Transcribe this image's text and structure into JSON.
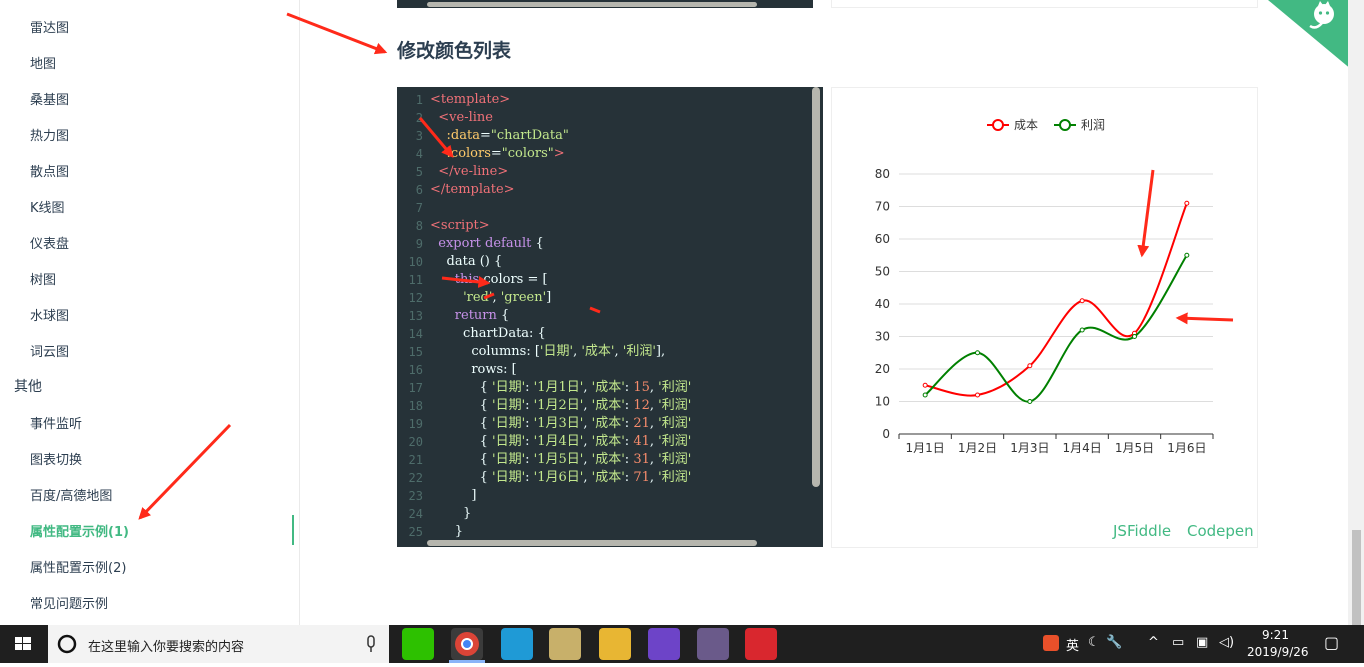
{
  "sidebar": {
    "items": [
      {
        "label": "雷达图",
        "active": false
      },
      {
        "label": "地图",
        "active": false
      },
      {
        "label": "桑基图",
        "active": false
      },
      {
        "label": "热力图",
        "active": false
      },
      {
        "label": "散点图",
        "active": false
      },
      {
        "label": "K线图",
        "active": false
      },
      {
        "label": "仪表盘",
        "active": false
      },
      {
        "label": "树图",
        "active": false
      },
      {
        "label": "水球图",
        "active": false
      },
      {
        "label": "词云图",
        "active": false
      }
    ],
    "group_label": "其他",
    "group_items": [
      {
        "label": "事件监听",
        "active": false
      },
      {
        "label": "图表切换",
        "active": false
      },
      {
        "label": "百度/高德地图",
        "active": false
      },
      {
        "label": "属性配置示例(1)",
        "active": true
      },
      {
        "label": "属性配置示例(2)",
        "active": false
      },
      {
        "label": "常见问题示例",
        "active": false
      }
    ]
  },
  "main": {
    "section_title": "修改颜色列表",
    "links": {
      "jsfiddle": "JSFiddle",
      "codepen": "Codepen"
    }
  },
  "code": {
    "line_numbers": [
      "1",
      "2",
      "3",
      "4",
      "5",
      "6",
      "7",
      "8",
      "9",
      "10",
      "11",
      "12",
      "13",
      "14",
      "15",
      "16",
      "17",
      "18",
      "19",
      "20",
      "21",
      "22",
      "23",
      "24",
      "25"
    ],
    "lines": [
      "<template>",
      "  <ve-line",
      "    :data=\"chartData\"",
      "    :colors=\"colors\">",
      "  </ve-line>",
      "</template>",
      "",
      "<script>",
      "  export default {",
      "    data () {",
      "      this.colors = [",
      "        'red', 'green']",
      "      return {",
      "        chartData: {",
      "          columns: ['日期', '成本', '利润'],",
      "          rows: [",
      "            { '日期': '1月1日', '成本': 15, '利润'",
      "            { '日期': '1月2日', '成本': 12, '利润'",
      "            { '日期': '1月3日', '成本': 21, '利润'",
      "            { '日期': '1月4日', '成本': 41, '利润'",
      "            { '日期': '1月5日', '成本': 31, '利润'",
      "            { '日期': '1月6日', '成本': 71, '利润'",
      "          ]",
      "        }",
      "      }"
    ]
  },
  "chart_data": {
    "type": "line",
    "categories": [
      "1月1日",
      "1月2日",
      "1月3日",
      "1月4日",
      "1月5日",
      "1月6日"
    ],
    "series": [
      {
        "name": "成本",
        "color": "#ff0000",
        "values": [
          15,
          12,
          21,
          41,
          31,
          71
        ]
      },
      {
        "name": "利润",
        "color": "#008000",
        "values": [
          12,
          25,
          10,
          32,
          30,
          55
        ]
      }
    ],
    "ylim": [
      0,
      80
    ],
    "yticks": [
      "0",
      "10",
      "20",
      "30",
      "40",
      "50",
      "60",
      "70",
      "80"
    ],
    "grid": true,
    "legend": "top-center",
    "smooth": true
  },
  "taskbar": {
    "search_placeholder": "在这里输入你要搜索的内容",
    "time": "9:21",
    "date": "2019/9/26",
    "ime_label": "英"
  },
  "colors": {
    "accent": "#42b983",
    "code_bg": "#263238",
    "annotation": "#ff2a1a"
  }
}
